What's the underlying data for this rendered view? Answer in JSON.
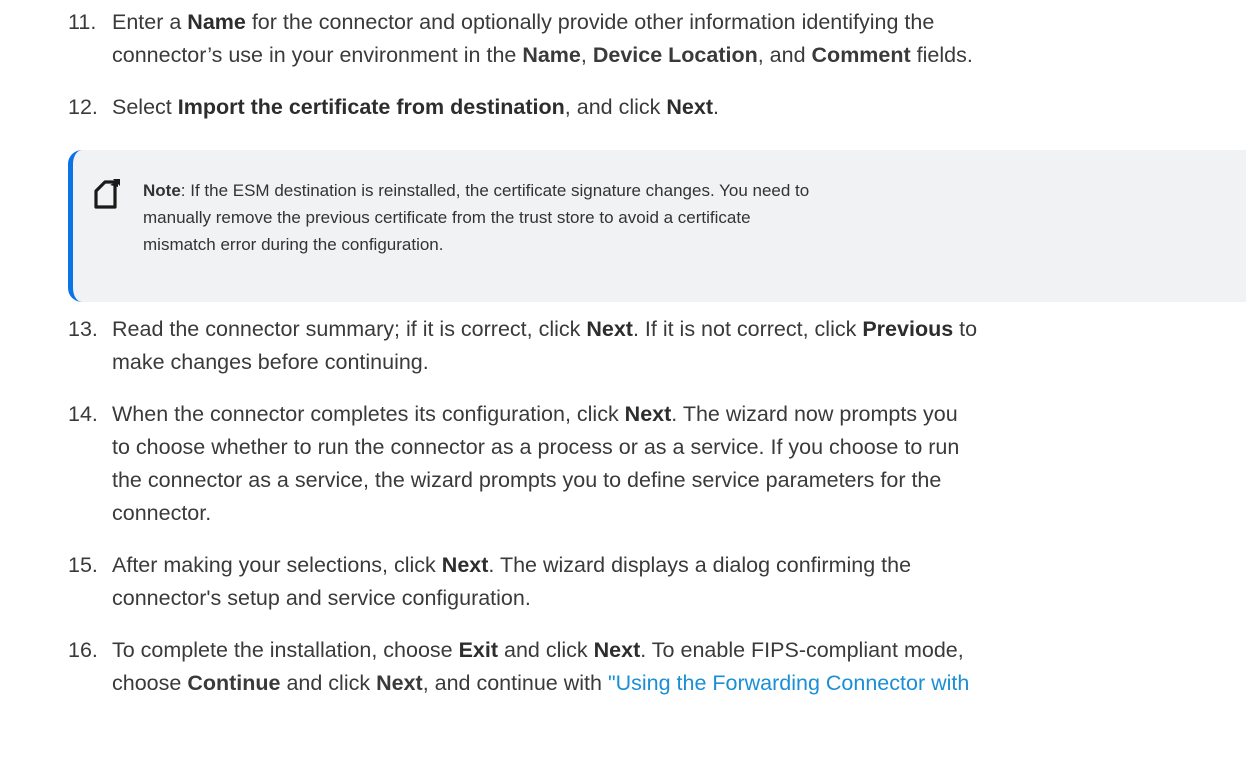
{
  "steps": [
    {
      "num": "11.",
      "parts": [
        "Enter a ",
        "Name",
        " for the connector and optionally provide other information identifying the",
        "connector’s use in your environment in the ",
        "Name",
        ", ",
        "Device Location",
        ", and ",
        "Comment",
        " fields."
      ]
    },
    {
      "num": "12.",
      "parts": [
        "Select ",
        "Import the certificate from destination",
        ", and click ",
        "Next",
        "."
      ]
    },
    {
      "num": "13.",
      "parts": [
        "Read the connector summary; if it is correct, click ",
        "Next",
        ". If it is not correct, click ",
        "Previous",
        " to",
        "make changes before continuing."
      ]
    },
    {
      "num": "14.",
      "parts": [
        "When the connector completes its configuration, click ",
        "Next",
        ". The wizard now prompts you",
        "to choose whether to run the connector as a process or as a service. If you choose to run",
        "the connector as a service, the wizard prompts you to define service parameters for the",
        "connector."
      ]
    },
    {
      "num": "15.",
      "parts": [
        "After making your selections, click ",
        "Next",
        ". The wizard displays a dialog confirming the",
        "connector's setup and service configuration."
      ]
    },
    {
      "num": "16.",
      "parts": [
        "To complete the installation, choose ",
        "Exit",
        " and click ",
        "Next",
        ". To enable FIPS-compliant mode,",
        "choose ",
        "Continue",
        " and click ",
        "Next",
        ", and continue with ",
        "\"Using the Forwarding Connector with"
      ]
    }
  ],
  "note": {
    "label": "Note",
    "line1": ": If the ESM destination is reinstalled, the certificate signature changes. You need to",
    "line2": "manually remove the previous certificate from the trust store to avoid a certificate",
    "line3": "mismatch error during the configuration.",
    "icon": "note-icon",
    "accent_color": "#0a73e6"
  }
}
